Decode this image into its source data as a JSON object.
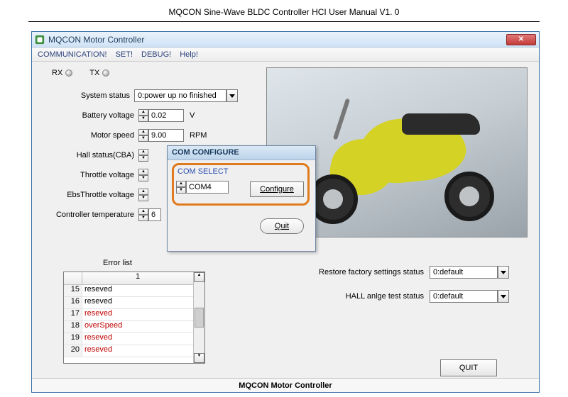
{
  "doc_title": "MQCON Sine-Wave BLDC Controller HCI User Manual V1. 0",
  "window": {
    "title": "MQCON Motor Controller",
    "menu": [
      "COMMUNICATION!",
      "SET!",
      "DEBUG!",
      "Help!"
    ]
  },
  "indicators": {
    "rx": "RX",
    "tx": "TX"
  },
  "fields": {
    "system_status": {
      "label": "System status",
      "value": "0:power up no finished"
    },
    "battery_voltage": {
      "label": "Battery voltage",
      "value": "0.02",
      "unit": "V"
    },
    "motor_speed": {
      "label": "Motor speed",
      "value": "9.00",
      "unit": "RPM"
    },
    "hall_status": {
      "label": "Hall status(CBA)",
      "value": ""
    },
    "throttle_voltage": {
      "label": "Throttle voltage",
      "value": ""
    },
    "ebs_throttle_voltage": {
      "label": "EbsThrottle voltage",
      "value": ""
    },
    "controller_temperature": {
      "label": "Controller temperature",
      "value": "6"
    }
  },
  "dialog": {
    "title": "COM CONFIGURE",
    "select_label": "COM SELECT",
    "select_value": "COM4",
    "configure": "Configure",
    "quit": "Quit"
  },
  "status": {
    "restore": {
      "label": "Restore factory settings status",
      "value": "0:default"
    },
    "hall_test": {
      "label": "HALL anlge test status",
      "value": "0:default"
    }
  },
  "error_list": {
    "title": "Error list",
    "col_header": "1",
    "rows": [
      {
        "n": "15",
        "text": "reseved",
        "red": false
      },
      {
        "n": "16",
        "text": "reseved",
        "red": false
      },
      {
        "n": "17",
        "text": "reseved",
        "red": true
      },
      {
        "n": "18",
        "text": "overSpeed",
        "red": true
      },
      {
        "n": "19",
        "text": "reseved",
        "red": true
      },
      {
        "n": "20",
        "text": "reseved",
        "red": true
      }
    ]
  },
  "quit_button": "QUIT",
  "footer": "MQCON Motor Controller"
}
